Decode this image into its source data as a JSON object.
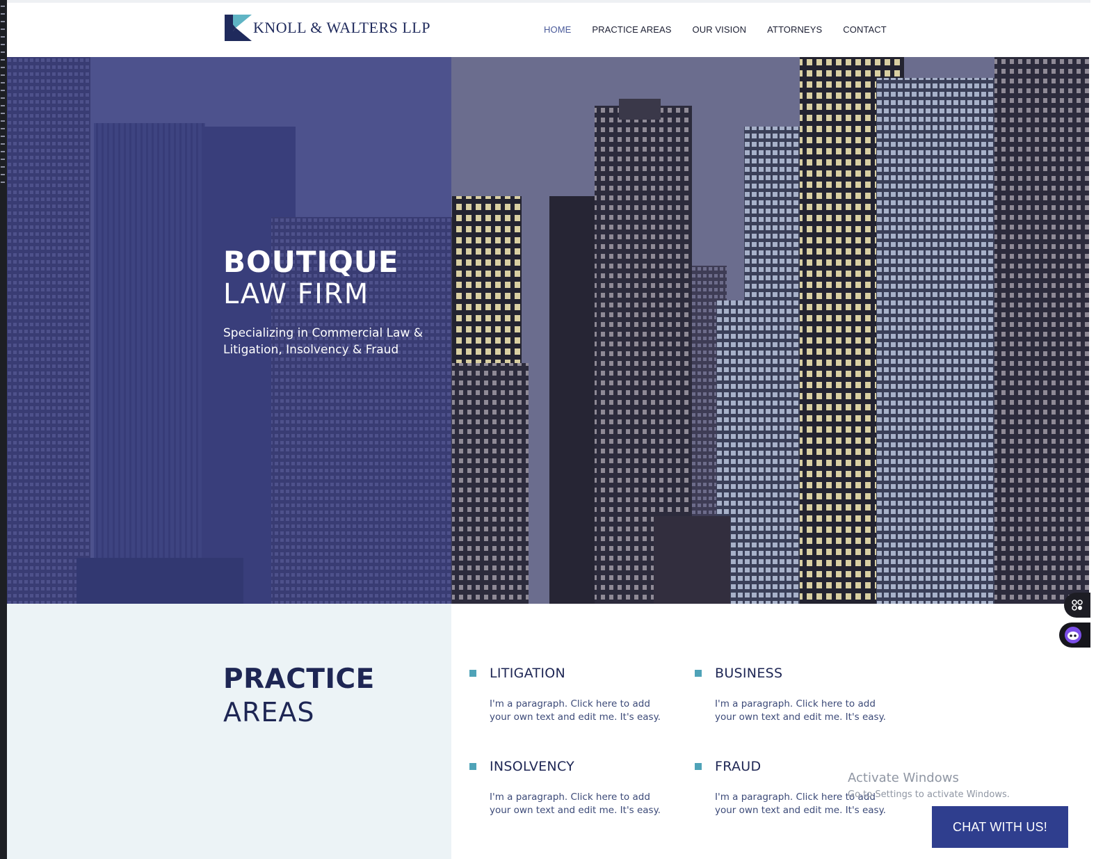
{
  "header": {
    "firm_name": "KNOLL & WALTERS LLP",
    "nav": [
      {
        "label": "HOME",
        "active": true
      },
      {
        "label": "PRACTICE AREAS",
        "active": false
      },
      {
        "label": "OUR VISION",
        "active": false
      },
      {
        "label": "ATTORNEYS",
        "active": false
      },
      {
        "label": "CONTACT",
        "active": false
      }
    ]
  },
  "hero": {
    "title_bold": "BOUTIQUE",
    "title_light": "LAW FIRM",
    "subtitle": "Specializing in Commercial Law & Litigation, Insolvency & Fraud"
  },
  "practice": {
    "title_bold": "PRACTICE",
    "title_light": "AREAS",
    "areas": [
      {
        "title": "LITIGATION",
        "text": "I'm a paragraph. Click here to add your own text and edit me. It's easy."
      },
      {
        "title": "BUSINESS",
        "text": "I'm a paragraph. Click here to add your own text and edit me. It's easy."
      },
      {
        "title": "INSOLVENCY",
        "text": "I'm a paragraph. Click here to add your own text and edit me. It's easy."
      },
      {
        "title": "FRAUD",
        "text": "I'm a paragraph. Click here to add your own text and edit me. It's easy."
      }
    ]
  },
  "chat": {
    "label": "CHAT WITH US!"
  },
  "windows_watermark": {
    "title": "Activate Windows",
    "subtitle": "Go to Settings to activate Windows."
  },
  "colors": {
    "brand_navy": "#1f2a5c",
    "accent_teal": "#4fa3b8",
    "chat_blue": "#2f3e8e",
    "practice_bg": "#ecf3f6"
  }
}
